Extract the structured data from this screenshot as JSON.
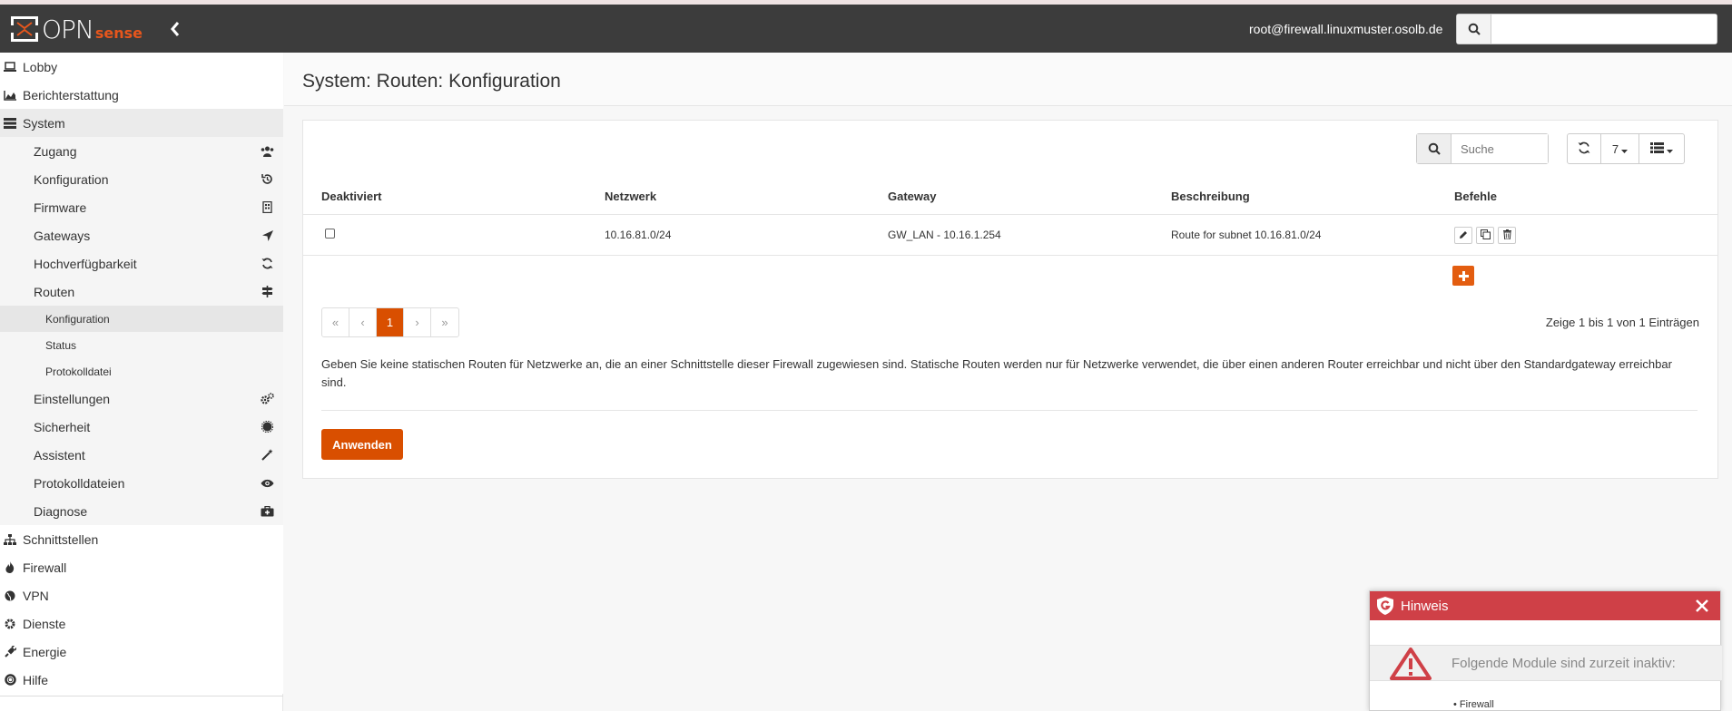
{
  "header": {
    "logo_text": "OPN",
    "logo_suffix": "sense",
    "user": "root@firewall.linuxmuster.osolb.de",
    "search_placeholder": ""
  },
  "sidebar": {
    "items": [
      {
        "label": "Lobby",
        "icon": "laptop-icon"
      },
      {
        "label": "Berichterstattung",
        "icon": "area-chart-icon"
      },
      {
        "label": "System",
        "icon": "server-icon"
      },
      {
        "label": "Zugang",
        "icon": "users-icon"
      },
      {
        "label": "Konfiguration",
        "icon": "history-icon"
      },
      {
        "label": "Firmware",
        "icon": "building-icon"
      },
      {
        "label": "Gateways",
        "icon": "location-arrow-icon"
      },
      {
        "label": "Hochverfügbarkeit",
        "icon": "refresh-icon"
      },
      {
        "label": "Routen",
        "icon": "map-signs-icon"
      },
      {
        "label": "Konfiguration"
      },
      {
        "label": "Status"
      },
      {
        "label": "Protokolldatei"
      },
      {
        "label": "Einstellungen",
        "icon": "cogs-icon"
      },
      {
        "label": "Sicherheit",
        "icon": "certificate-icon"
      },
      {
        "label": "Assistent",
        "icon": "magic-icon"
      },
      {
        "label": "Protokolldateien",
        "icon": "eye-icon"
      },
      {
        "label": "Diagnose",
        "icon": "medkit-icon"
      },
      {
        "label": "Schnittstellen",
        "icon": "sitemap-icon"
      },
      {
        "label": "Firewall",
        "icon": "fire-icon"
      },
      {
        "label": "VPN",
        "icon": "globe-icon"
      },
      {
        "label": "Dienste",
        "icon": "cog-icon"
      },
      {
        "label": "Energie",
        "icon": "plug-icon"
      },
      {
        "label": "Hilfe",
        "icon": "life-ring-icon"
      }
    ]
  },
  "page": {
    "title": "System: Routen: Konfiguration"
  },
  "grid": {
    "search_placeholder": "Suche",
    "page_size": "7",
    "columns": [
      "Deaktiviert",
      "Netzwerk",
      "Gateway",
      "Beschreibung",
      "Befehle"
    ],
    "rows": [
      {
        "disabled": false,
        "network": "10.16.81.0/24",
        "gateway": "GW_LAN - 10.16.1.254",
        "description": "Route for subnet 10.16.81.0/24"
      }
    ],
    "pager": [
      "«",
      "‹",
      "1",
      "›",
      "»"
    ],
    "info": "Zeige 1 bis 1 von 1 Einträgen"
  },
  "note": "Geben Sie keine statischen Routen für Netzwerke an, die an einer Schnittstelle dieser Firewall zugewiesen sind. Statische Routen werden nur für Netzwerke verwendet, die über einen anderen Router erreichbar und nicht über den Standardgateway erreichbar sind.",
  "apply_label": "Anwenden",
  "notice": {
    "title": "Hinweis",
    "message": "Folgende Module sind zurzeit inaktiv:",
    "list_item": "• Firewall"
  },
  "colors": {
    "accent": "#d94f00",
    "navbar": "#3c3c3c",
    "notice_header": "#cf4047"
  }
}
